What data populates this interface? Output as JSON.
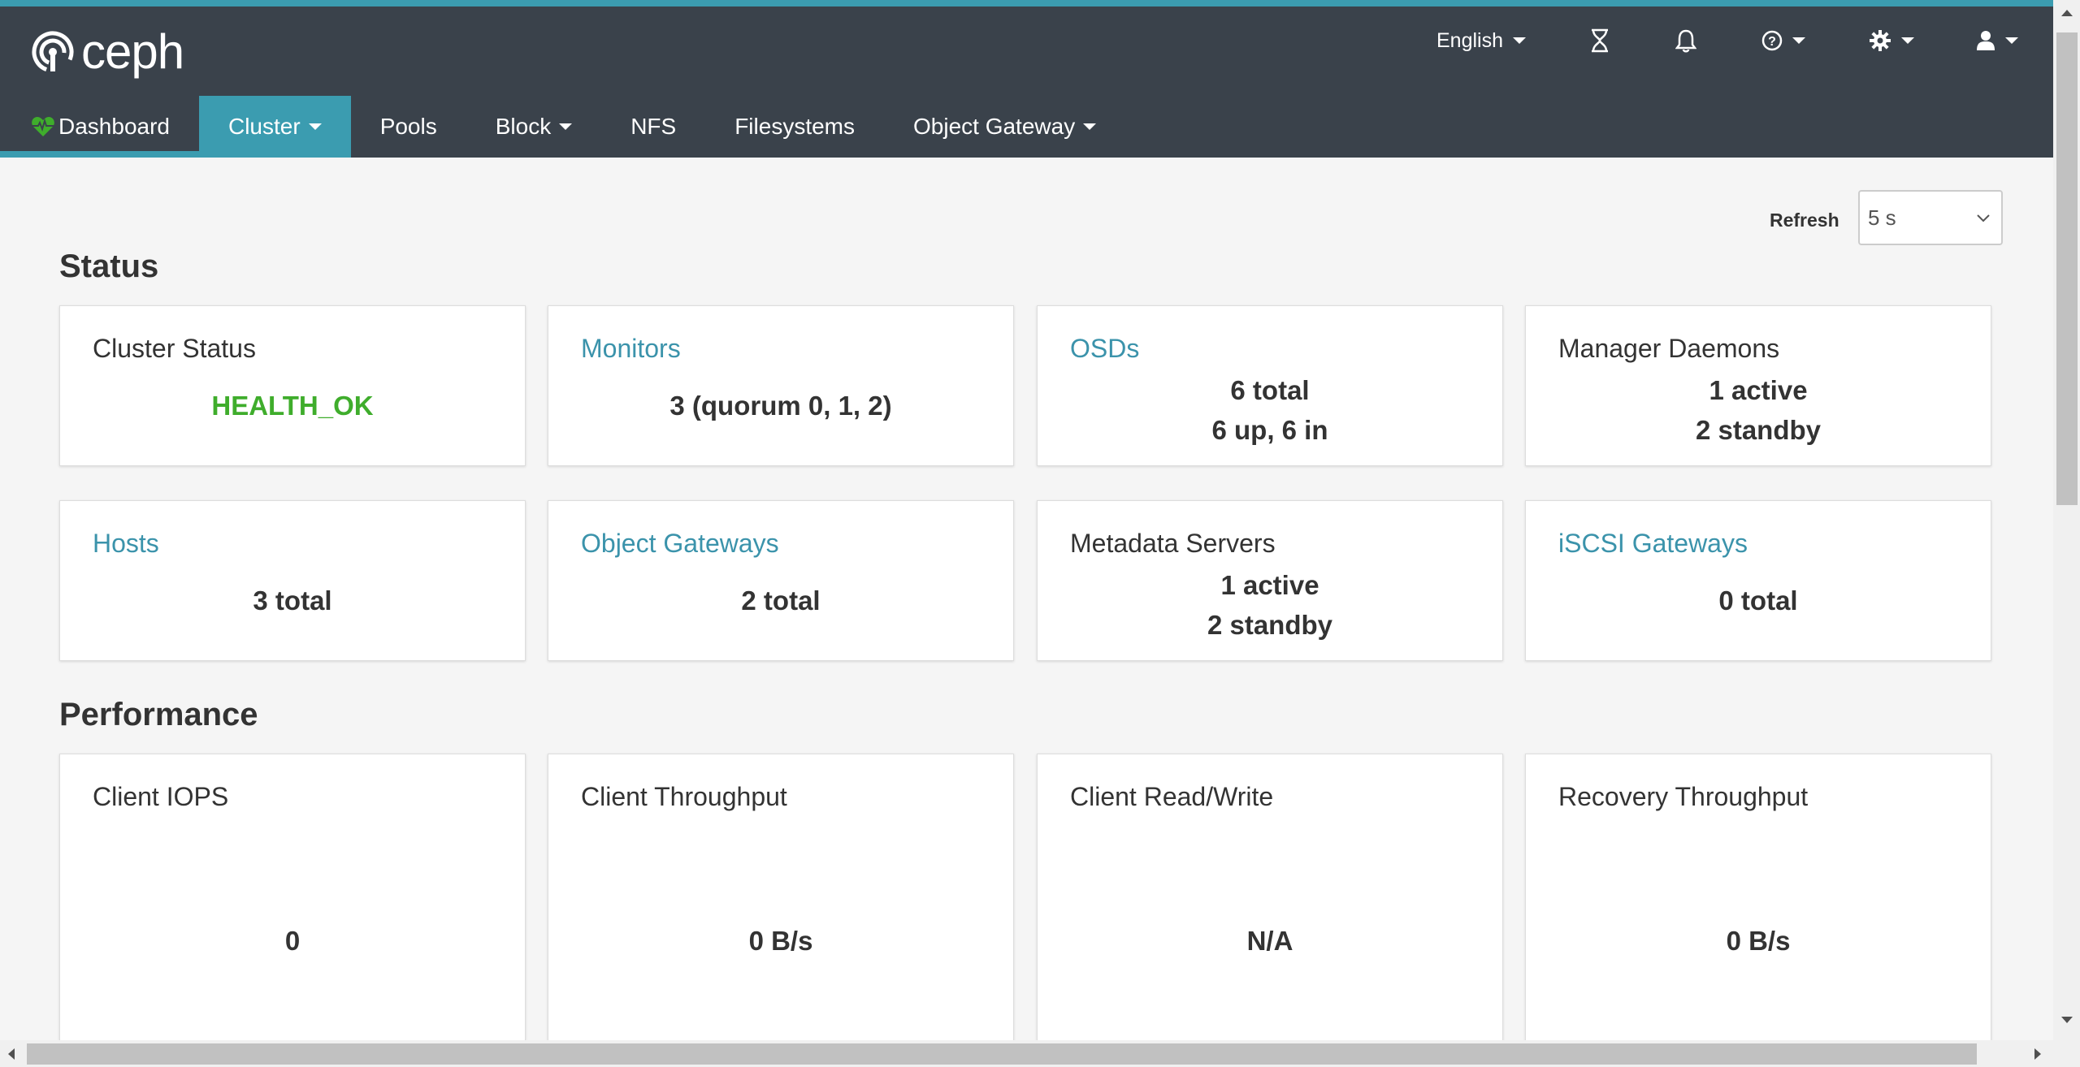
{
  "brand": {
    "name": "ceph",
    "accent": "#3b9cb0",
    "navbar_bg": "#3a424b"
  },
  "utility": {
    "language": "English",
    "icons": [
      "hourglass-icon",
      "bell-icon",
      "help-icon",
      "gear-icon",
      "user-icon"
    ]
  },
  "nav": {
    "dashboard": "Dashboard",
    "cluster": "Cluster",
    "pools": "Pools",
    "block": "Block",
    "nfs": "NFS",
    "filesystems": "Filesystems",
    "object_gateway": "Object Gateway"
  },
  "refresh": {
    "label": "Refresh",
    "value": "5 s"
  },
  "status": {
    "title": "Status",
    "cluster_status": {
      "title": "Cluster Status",
      "value": "HEALTH_OK",
      "color": "#3fad2c"
    },
    "monitors": {
      "title": "Monitors",
      "value": "3 (quorum 0, 1, 2)"
    },
    "osds": {
      "title": "OSDs",
      "line1": "6 total",
      "line2": "6 up, 6 in"
    },
    "manager_daemons": {
      "title": "Manager Daemons",
      "line1": "1 active",
      "line2": "2 standby"
    },
    "hosts": {
      "title": "Hosts",
      "value": "3 total"
    },
    "object_gateways": {
      "title": "Object Gateways",
      "value": "2 total"
    },
    "metadata_servers": {
      "title": "Metadata Servers",
      "line1": "1 active",
      "line2": "2 standby"
    },
    "iscsi_gateways": {
      "title": "iSCSI Gateways",
      "value": "0 total"
    }
  },
  "performance": {
    "title": "Performance",
    "client_iops": {
      "title": "Client IOPS",
      "value": "0"
    },
    "client_throughput": {
      "title": "Client Throughput",
      "value": "0 B/s"
    },
    "client_read_write": {
      "title": "Client Read/Write",
      "value": "N/A"
    },
    "recovery_throughput": {
      "title": "Recovery Throughput",
      "value": "0 B/s"
    }
  }
}
